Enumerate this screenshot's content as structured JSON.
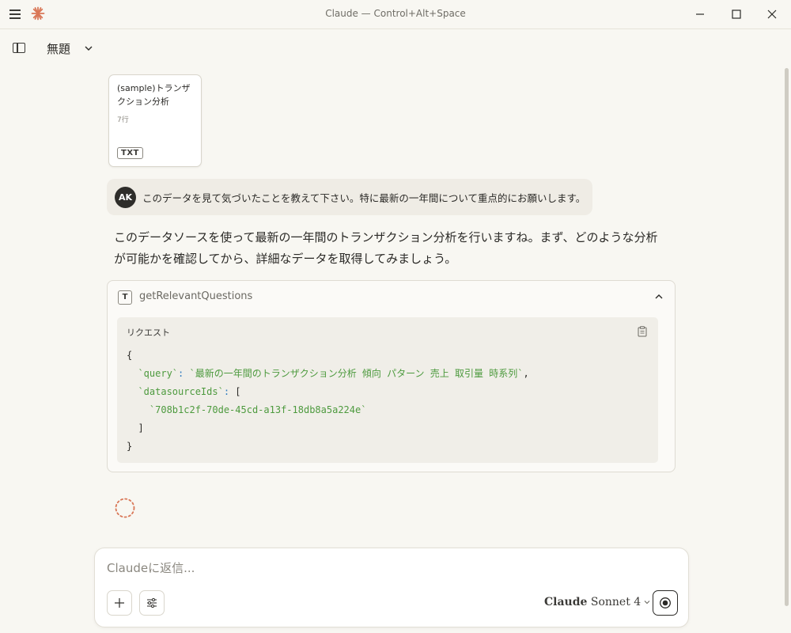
{
  "window": {
    "title": "Claude — Control+Alt+Space"
  },
  "toolbar": {
    "doc_title": "無題"
  },
  "attachment": {
    "name": "(sample)トランザクション分析",
    "lines": "7行",
    "type": "TXT"
  },
  "user_message": {
    "avatar_initials": "AK",
    "text": "このデータを見て気づいたことを教えて下さい。特に最新の一年間について重点的にお願いします。"
  },
  "assistant": {
    "text": "このデータソースを使って最新の一年間のトランザクション分析を行いますね。まず、どのような分析が可能かを確認してから、詳細なデータを取得してみましょう。"
  },
  "tool_call": {
    "icon_letter": "T",
    "name": "getRelevantQuestions",
    "request_label": "リクエスト",
    "code": {
      "open_brace": "{",
      "query_key": "`query`",
      "query_value": "`最新の一年間のトランザクション分析 傾向 パターン 売上 取引量 時系列`",
      "datasource_key": "`datasourceIds`",
      "open_bracket": "[",
      "datasource_id": "`708b1c2f-70de-45cd-a13f-18db8a5a224e`",
      "close_bracket": "]",
      "close_brace": "}"
    }
  },
  "composer": {
    "placeholder": "Claudeに返信...",
    "model_brand": "Claude",
    "model_name": "Sonnet 4"
  },
  "colors": {
    "accent": "#d97757",
    "background": "#f8f7f2",
    "code_string": "#4d9a3e"
  }
}
